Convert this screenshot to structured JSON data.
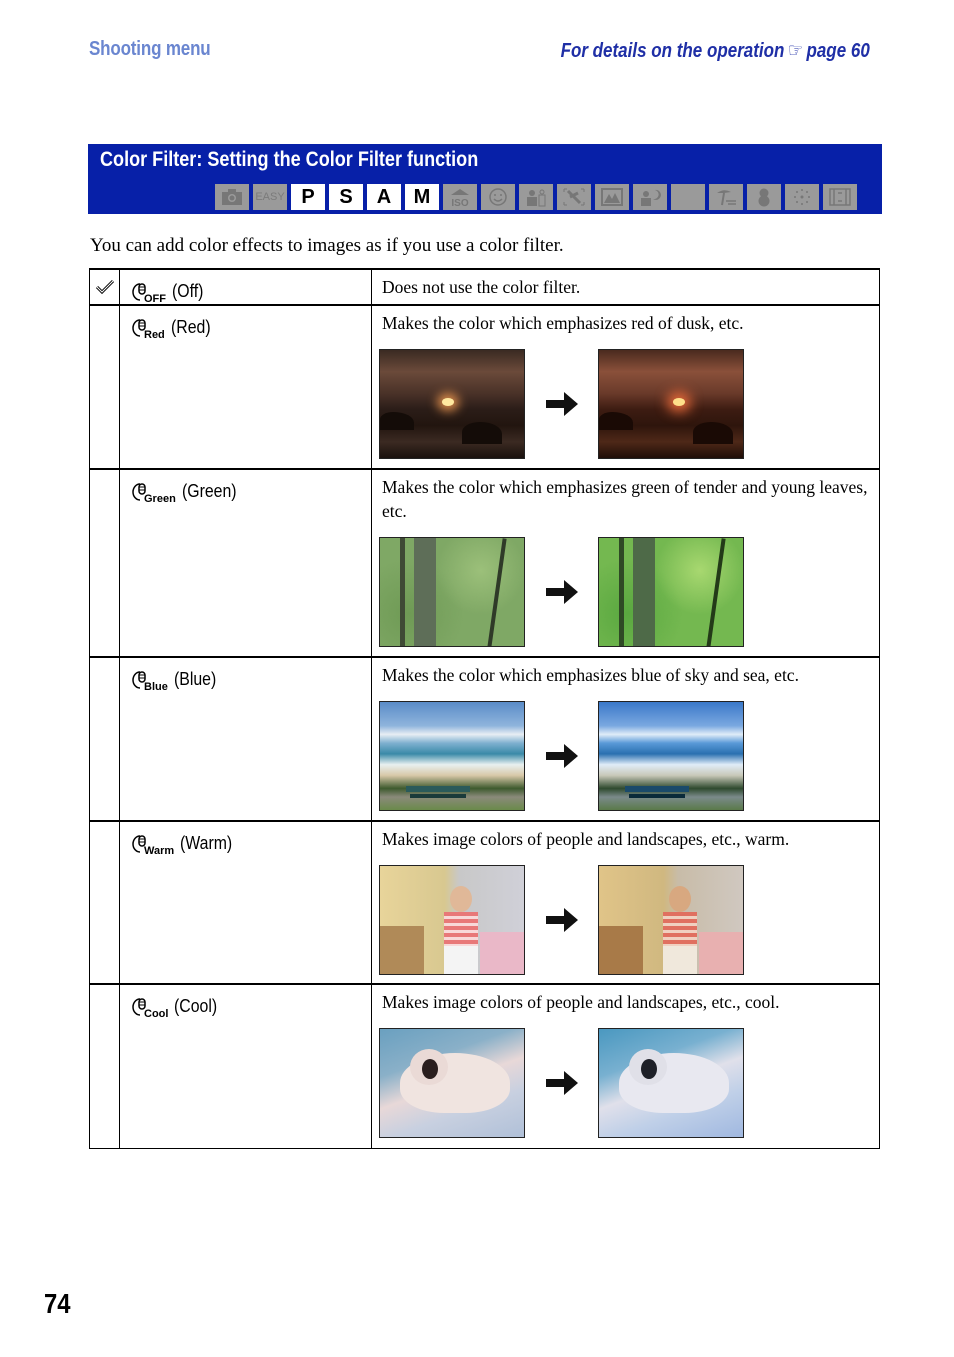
{
  "header": {
    "section": "Shooting menu",
    "details_prefix": "For details on the operation",
    "details_icon": "pointing-hand-icon",
    "details_page": "page 60"
  },
  "title_bar": {
    "title": "Color Filter: Setting the Color Filter function",
    "bg_color": "#0720a8",
    "modes": [
      {
        "id": "auto",
        "icon": "camera-icon",
        "label": "",
        "available": false
      },
      {
        "id": "easy",
        "icon": "easy-icon",
        "label": "EASY",
        "available": false
      },
      {
        "id": "p",
        "icon": "",
        "label": "P",
        "available": true
      },
      {
        "id": "s",
        "icon": "",
        "label": "S",
        "available": true
      },
      {
        "id": "a",
        "icon": "",
        "label": "A",
        "available": true
      },
      {
        "id": "m",
        "icon": "",
        "label": "M",
        "available": true
      },
      {
        "id": "high-sensitivity",
        "icon": "iso-icon",
        "label": "ISO",
        "available": false
      },
      {
        "id": "smile",
        "icon": "smile-icon",
        "label": "",
        "available": false
      },
      {
        "id": "soft-snap",
        "icon": "soft-snap-icon",
        "label": "",
        "available": false
      },
      {
        "id": "anti-blur",
        "icon": "anti-blur-icon",
        "label": "",
        "available": false
      },
      {
        "id": "landscape",
        "icon": "landscape-icon",
        "label": "",
        "available": false
      },
      {
        "id": "twilight-portrait",
        "icon": "twilight-portrait-icon",
        "label": "",
        "available": false
      },
      {
        "id": "twilight",
        "icon": "moon-icon",
        "label": "",
        "available": false
      },
      {
        "id": "beach",
        "icon": "beach-icon",
        "label": "",
        "available": false
      },
      {
        "id": "snow",
        "icon": "snow-icon",
        "label": "",
        "available": false
      },
      {
        "id": "fireworks",
        "icon": "fireworks-icon",
        "label": "",
        "available": false
      },
      {
        "id": "movie",
        "icon": "movie-icon",
        "label": "",
        "available": false
      }
    ]
  },
  "intro": "You can add color effects to images as if you use a color filter.",
  "options": [
    {
      "sub": "OFF",
      "label": "(Off)",
      "default": true,
      "description": "Does not use the color filter.",
      "images": null
    },
    {
      "sub": "Red",
      "label": "(Red)",
      "default": false,
      "description": "Makes the color which emphasizes red of dusk, etc.",
      "images": {
        "before": "sunset-original",
        "after": "sunset-red-filter"
      }
    },
    {
      "sub": "Green",
      "label": "(Green)",
      "default": false,
      "description": "Makes the color which emphasizes green of tender and young leaves, etc.",
      "images": {
        "before": "forest-original",
        "after": "forest-green-filter"
      }
    },
    {
      "sub": "Blue",
      "label": "(Blue)",
      "default": false,
      "description": "Makes the color which emphasizes blue of sky and sea, etc.",
      "images": {
        "before": "beach-original",
        "after": "beach-blue-filter"
      }
    },
    {
      "sub": "Warm",
      "label": "(Warm)",
      "default": false,
      "description": "Makes image colors of people and landscapes, etc., warm.",
      "images": {
        "before": "girl-original",
        "after": "girl-warm-filter"
      }
    },
    {
      "sub": "Cool",
      "label": "(Cool)",
      "default": false,
      "description": "Makes image colors of people and landscapes, etc., cool.",
      "images": {
        "before": "cat-original",
        "after": "cat-cool-filter"
      }
    }
  ],
  "page_number": "74"
}
